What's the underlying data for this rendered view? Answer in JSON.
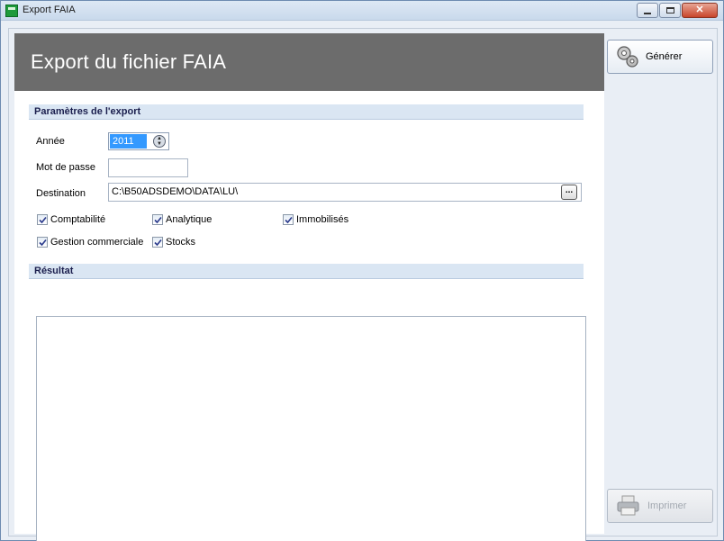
{
  "window": {
    "title": "Export FAIA",
    "minimize_label": "minimize",
    "maximize_label": "maximize",
    "close_label": "close"
  },
  "header": {
    "title": "Export du fichier FAIA"
  },
  "params": {
    "section_title": "Paramètres de l'export",
    "year_label": "Année",
    "year_value": "2011",
    "password_label": "Mot de passe",
    "password_value": "",
    "destination_label": "Destination",
    "destination_value": "C:\\B50ADSDEMO\\DATA\\LU\\",
    "browse_label": "..."
  },
  "checkboxes": [
    {
      "label": "Comptabilité",
      "checked": true
    },
    {
      "label": "Analytique",
      "checked": true
    },
    {
      "label": "Immobilisés",
      "checked": true
    },
    {
      "label": "Gestion commerciale",
      "checked": true
    },
    {
      "label": "Stocks",
      "checked": true
    }
  ],
  "result": {
    "section_title": "Résultat",
    "content": ""
  },
  "actions": {
    "generate_label": "Générer",
    "generate_icon": "gears-icon",
    "print_label": "Imprimer",
    "print_icon": "printer-icon",
    "print_enabled": false
  },
  "colors": {
    "header_bg": "#6c6c6c",
    "section_bg": "#dae6f3",
    "selection": "#3399ff"
  }
}
